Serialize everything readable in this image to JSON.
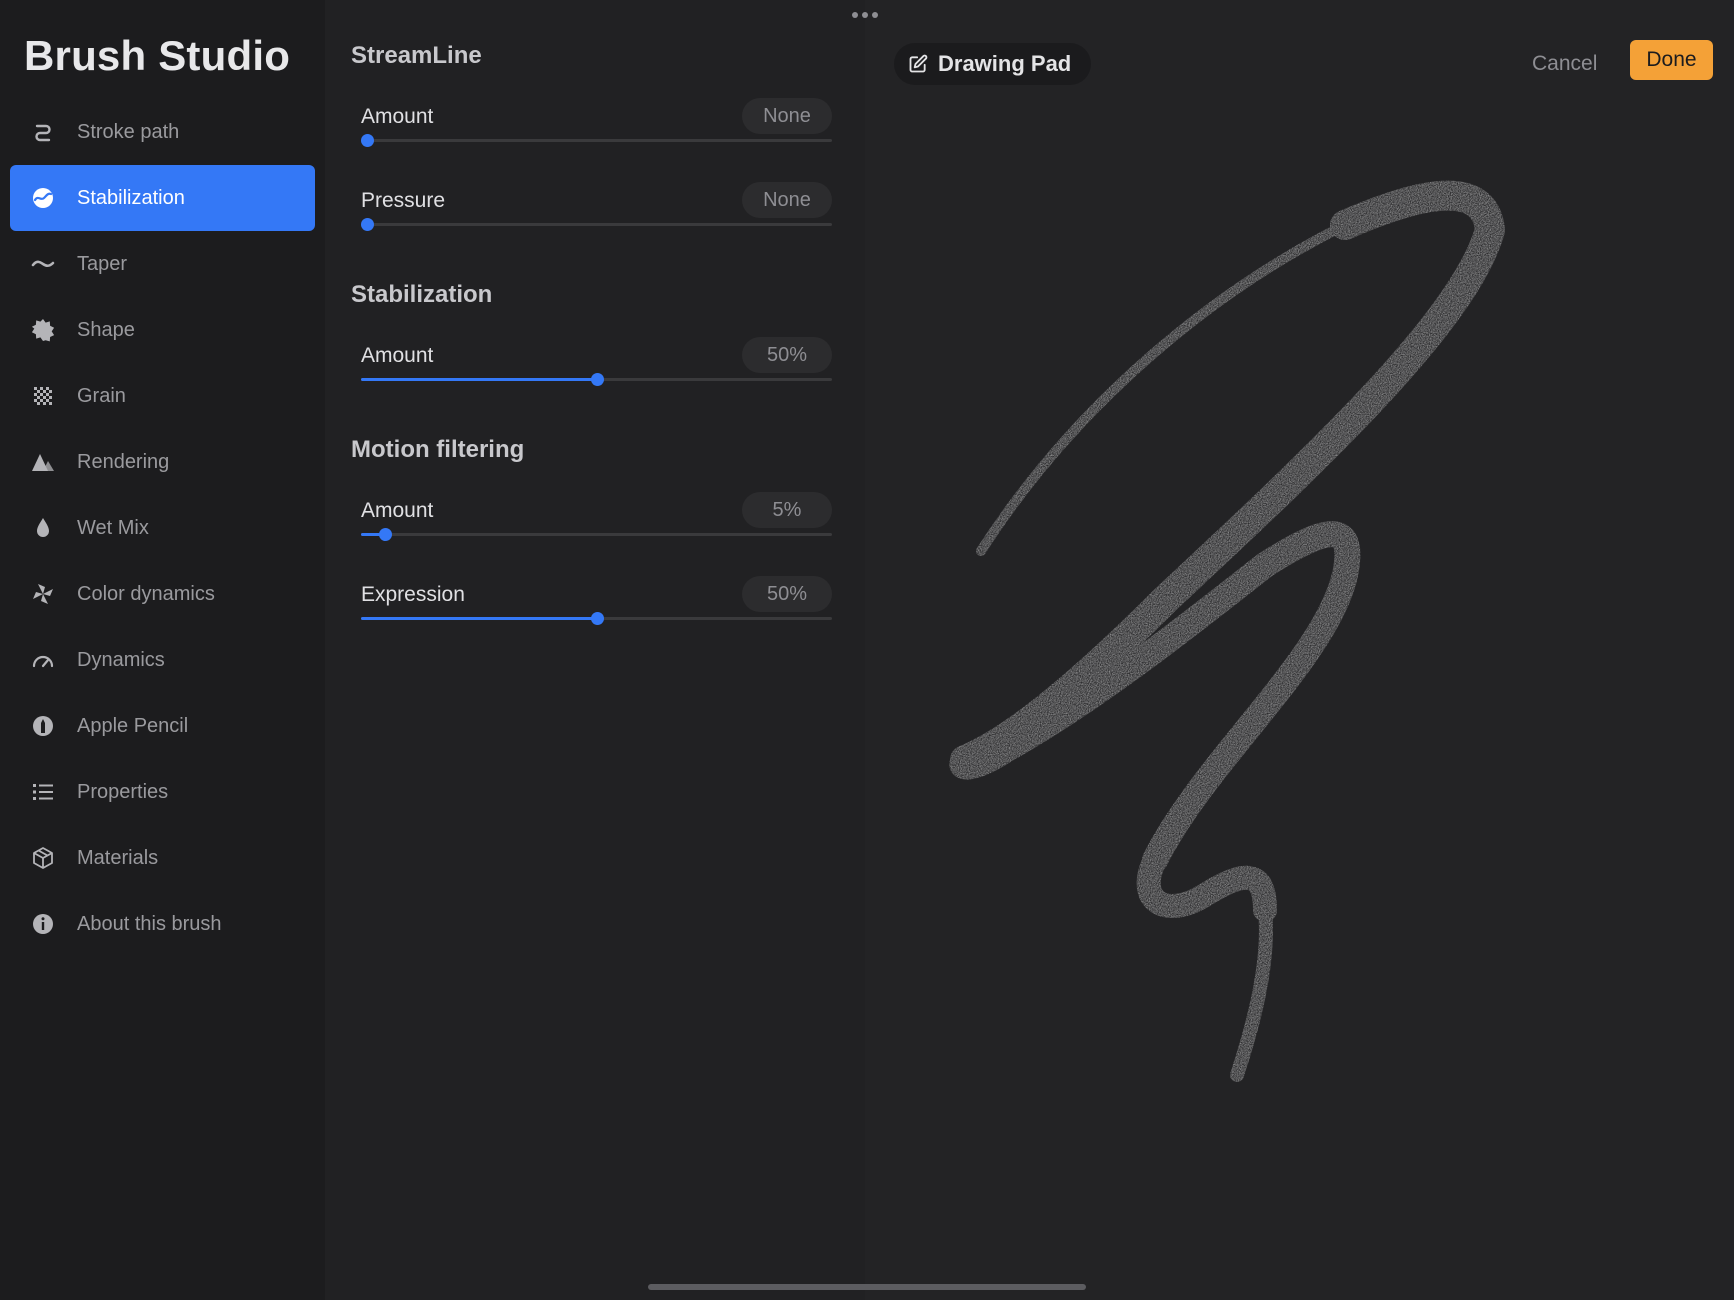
{
  "app_title": "Brush Studio",
  "sidebar": {
    "items": [
      {
        "label": "Stroke path",
        "icon": "stroke-path-icon"
      },
      {
        "label": "Stabilization",
        "icon": "stabilization-icon",
        "selected": true
      },
      {
        "label": "Taper",
        "icon": "taper-icon"
      },
      {
        "label": "Shape",
        "icon": "shape-icon"
      },
      {
        "label": "Grain",
        "icon": "grain-icon"
      },
      {
        "label": "Rendering",
        "icon": "rendering-icon"
      },
      {
        "label": "Wet Mix",
        "icon": "wet-mix-icon"
      },
      {
        "label": "Color dynamics",
        "icon": "color-dynamics-icon"
      },
      {
        "label": "Dynamics",
        "icon": "dynamics-icon"
      },
      {
        "label": "Apple Pencil",
        "icon": "apple-pencil-icon"
      },
      {
        "label": "Properties",
        "icon": "properties-icon"
      },
      {
        "label": "Materials",
        "icon": "materials-icon"
      },
      {
        "label": "About this brush",
        "icon": "info-icon"
      }
    ]
  },
  "settings": {
    "streamline": {
      "title": "StreamLine",
      "amount": {
        "label": "Amount",
        "value": "None",
        "level": 0.0
      },
      "pressure": {
        "label": "Pressure",
        "value": "None",
        "level": 0.0
      }
    },
    "stabilization": {
      "title": "Stabilization",
      "amount": {
        "label": "Amount",
        "value": "50%",
        "level": 0.5
      }
    },
    "motion_filtering": {
      "title": "Motion filtering",
      "amount": {
        "label": "Amount",
        "value": "5%",
        "level": 0.05
      },
      "expression": {
        "label": "Expression",
        "value": "50%",
        "level": 0.5
      }
    }
  },
  "drawing_pad": {
    "label": "Drawing Pad",
    "icon": "edit-icon"
  },
  "toolbar": {
    "cancel_label": "Cancel",
    "done_label": "Done"
  },
  "colors": {
    "accent": "#3478f6",
    "done": "#f4a137",
    "stroke": "#ececec"
  }
}
